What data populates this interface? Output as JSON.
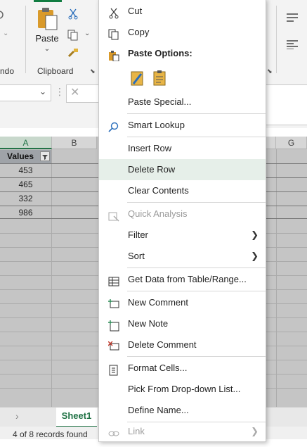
{
  "ribbon": {
    "left_group_label": "ndo",
    "clipboard_label": "Clipboard",
    "paste_label": "Paste"
  },
  "grid": {
    "columns": [
      "A",
      "B",
      "G"
    ],
    "header_cell": "Values",
    "values": [
      "453",
      "465",
      "332",
      "986"
    ]
  },
  "sheet_tab": "Sheet1",
  "status": "4 of 8 records found",
  "menu": {
    "items": [
      {
        "label": "Cut",
        "icon": "scissors-icon"
      },
      {
        "label": "Copy",
        "icon": "copy-icon"
      },
      {
        "label": "Paste Options:",
        "icon": "paste-icon"
      },
      {
        "label": "Paste Special...",
        "icon": ""
      },
      {
        "label": "Smart Lookup",
        "icon": "search-icon"
      },
      {
        "label": "Insert Row",
        "icon": ""
      },
      {
        "label": "Delete Row",
        "icon": ""
      },
      {
        "label": "Clear Contents",
        "icon": ""
      },
      {
        "label": "Quick Analysis",
        "icon": "quick-analysis-icon"
      },
      {
        "label": "Filter",
        "icon": ""
      },
      {
        "label": "Sort",
        "icon": ""
      },
      {
        "label": "Get Data from Table/Range...",
        "icon": "table-icon"
      },
      {
        "label": "New Comment",
        "icon": "new-comment-icon"
      },
      {
        "label": "New Note",
        "icon": "new-note-icon"
      },
      {
        "label": "Delete Comment",
        "icon": "delete-comment-icon"
      },
      {
        "label": "Format Cells...",
        "icon": "format-cells-icon"
      },
      {
        "label": "Pick From Drop-down List...",
        "icon": ""
      },
      {
        "label": "Define Name...",
        "icon": ""
      },
      {
        "label": "Link",
        "icon": "link-icon"
      }
    ],
    "hovered_item": "Delete Row",
    "colors": {
      "hover": "#e6efe9",
      "accent": "#217346"
    }
  }
}
